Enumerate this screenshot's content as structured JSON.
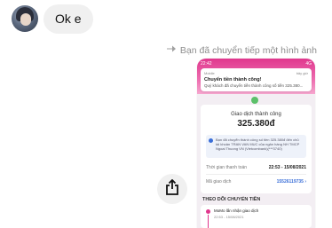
{
  "message": {
    "text": "Ok e"
  },
  "forward_notice": "Bạn đã chuyển tiếp một hình ảnh",
  "screenshot": {
    "status_left": "22:42",
    "status_right": "4G",
    "notification": {
      "app": "Mobile",
      "time": "bây giờ",
      "title": "Chuyển tiền thành công!",
      "body": "Quý khách đã chuyển tiền thành công số tiền 325.380..."
    },
    "result": {
      "title": "Giao dịch thành công",
      "amount": "325.380đ",
      "info": "Bạn đã chuyển thành công số tiền 325.380đ đến chủ tài khoản TRAN VAN MUC của ngân hàng NH TMCP Ngoai Thuong VN (Vietcombank)(***3740)",
      "time_label": "Thời gian thanh toán",
      "time_value": "22:53 - 15/08/2021",
      "code_label": "Mã giao dịch",
      "code_value": "15526119735 ›"
    },
    "tracking": {
      "header": "THEO DÕI CHUYỂN TIỀN",
      "step_label": "MoMo lấn nhận giao dịch",
      "step_time": "22:53 - 15/08/2021"
    }
  }
}
